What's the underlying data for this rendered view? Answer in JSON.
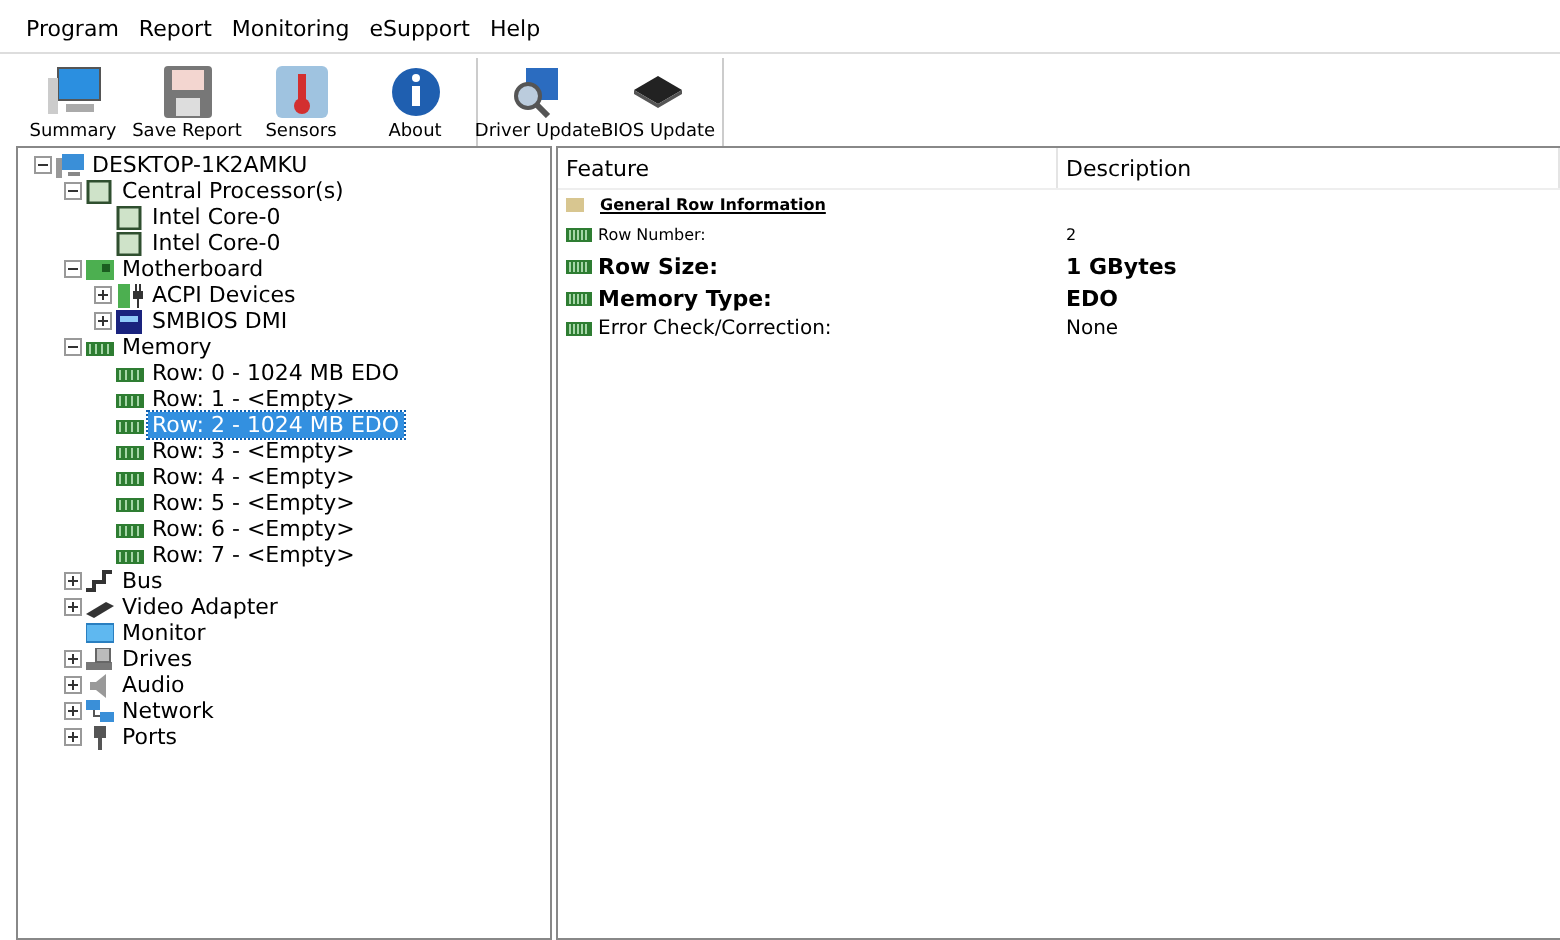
{
  "menu": [
    "Program",
    "Report",
    "Monitoring",
    "eSupport",
    "Help"
  ],
  "toolbar_groups": [
    {
      "buttons": [
        {
          "label": "Summary",
          "kind": "monitor"
        },
        {
          "label": "Save Report",
          "kind": "floppy"
        },
        {
          "label": "Sensors",
          "kind": "thermometer"
        },
        {
          "label": "About",
          "kind": "info"
        }
      ]
    },
    {
      "buttons": [
        {
          "label": "Driver Update",
          "kind": "search"
        },
        {
          "label": "BIOS Update",
          "kind": "chip"
        }
      ]
    }
  ],
  "tree": [
    {
      "label": "DESKTOP-1K2AMKU",
      "kind": "computer",
      "expanded": true,
      "selected": false,
      "children": [
        {
          "label": "Central Processor(s)",
          "kind": "cpu",
          "expanded": true,
          "selected": false,
          "children": [
            {
              "label": "Intel Core-0",
              "kind": "cpu",
              "selected": false
            },
            {
              "label": "Intel Core-0",
              "kind": "cpu",
              "selected": false
            }
          ]
        },
        {
          "label": "Motherboard",
          "kind": "board",
          "expanded": true,
          "selected": false,
          "children": [
            {
              "label": "ACPI Devices",
              "kind": "battery",
              "expanded": false,
              "selected": false
            },
            {
              "label": "SMBIOS DMI",
              "kind": "dmi",
              "expanded": false,
              "selected": false
            }
          ]
        },
        {
          "label": "Memory",
          "kind": "memory",
          "expanded": true,
          "selected": false,
          "children": [
            {
              "label": "Row: 0 - 1024 MB EDO",
              "kind": "memory",
              "selected": false
            },
            {
              "label": "Row: 1 - <Empty>",
              "kind": "memory",
              "selected": false
            },
            {
              "label": "Row: 2 - 1024 MB EDO",
              "kind": "memory",
              "selected": true
            },
            {
              "label": "Row: 3 - <Empty>",
              "kind": "memory",
              "selected": false
            },
            {
              "label": "Row: 4 - <Empty>",
              "kind": "memory",
              "selected": false
            },
            {
              "label": "Row: 5 - <Empty>",
              "kind": "memory",
              "selected": false
            },
            {
              "label": "Row: 6 - <Empty>",
              "kind": "memory",
              "selected": false
            },
            {
              "label": "Row: 7 - <Empty>",
              "kind": "memory",
              "selected": false
            }
          ]
        },
        {
          "label": "Bus",
          "kind": "bus",
          "expanded": false,
          "selected": false
        },
        {
          "label": "Video Adapter",
          "kind": "video",
          "expanded": false,
          "selected": false
        },
        {
          "label": "Monitor",
          "kind": "monitor",
          "selected": false
        },
        {
          "label": "Drives",
          "kind": "drive",
          "expanded": false,
          "selected": false
        },
        {
          "label": "Audio",
          "kind": "speaker",
          "expanded": false,
          "selected": false
        },
        {
          "label": "Network",
          "kind": "network",
          "expanded": false,
          "selected": false
        },
        {
          "label": "Ports",
          "kind": "port",
          "expanded": false,
          "selected": false
        }
      ]
    }
  ],
  "details": {
    "columns": [
      "Feature",
      "Description"
    ],
    "rows": [
      {
        "kind": "heading",
        "feature": "General Row Information"
      },
      {
        "kind": "minor",
        "feature": "Row Number:",
        "value": "2"
      },
      {
        "kind": "major",
        "feature": "Row Size:",
        "value": "1 GBytes"
      },
      {
        "kind": "major",
        "feature": "Memory Type:",
        "value": "EDO"
      },
      {
        "kind": "plain",
        "feature": "Error Check/Correction:",
        "value": "None"
      }
    ]
  }
}
